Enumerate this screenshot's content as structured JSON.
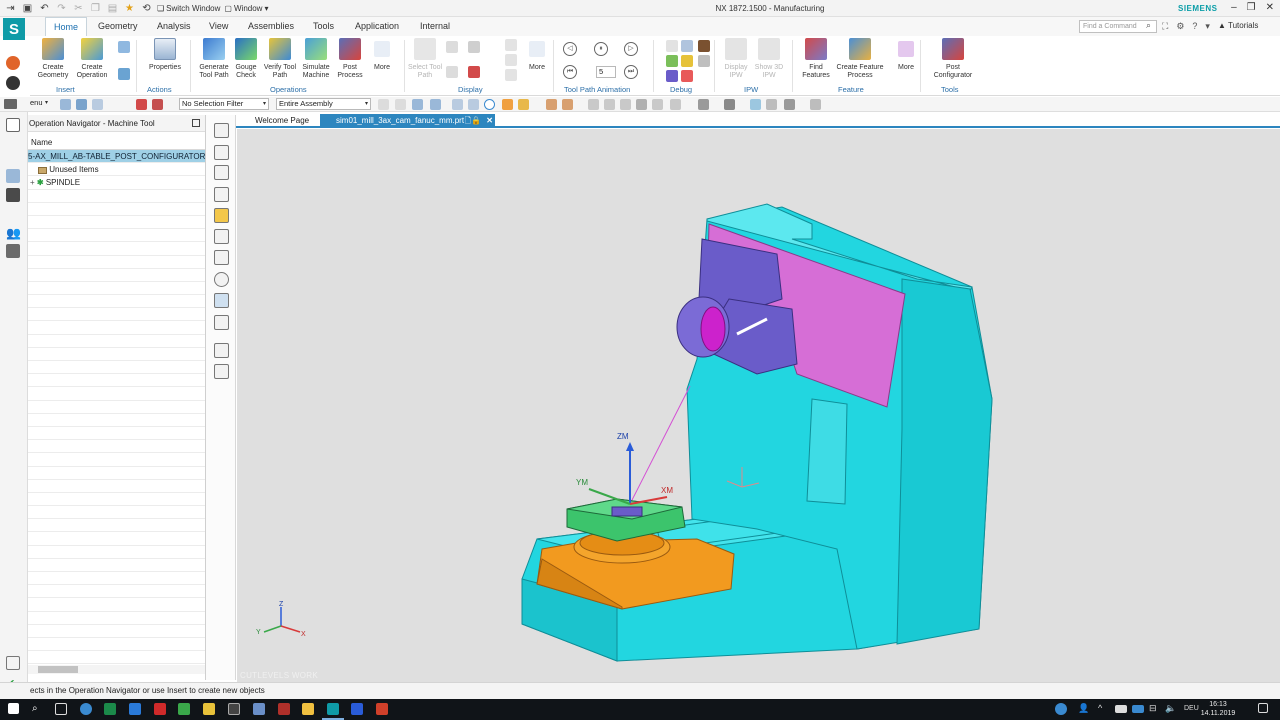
{
  "window": {
    "title": "NX 1872.1500 - Manufacturing",
    "brand": "SIEMENS",
    "switch_window_label": "Switch Window",
    "window_menu_label": "Window"
  },
  "tabs": [
    "Home",
    "Geometry",
    "Analysis",
    "View",
    "Assemblies",
    "Tools",
    "Application",
    "Internal"
  ],
  "command_search": {
    "placeholder": "Find a Command"
  },
  "tutorials_label": "Tutorials",
  "ribbon": {
    "insert": {
      "label": "Insert",
      "create_geometry": "Create Geometry",
      "create_operation": "Create Operation"
    },
    "actions": {
      "label": "Actions",
      "properties": "Properties"
    },
    "operations": {
      "label": "Operations",
      "generate_tool_path": "Generate Tool Path",
      "gouge_check": "Gouge Check",
      "verify_tool_path": "Verify Tool Path",
      "simulate_machine": "Simulate Machine",
      "post_process": "Post Process",
      "more": "More"
    },
    "display": {
      "label": "Display",
      "select_tool_path": "Select Tool Path",
      "more": "More"
    },
    "tool_path_animation": {
      "label": "Tool Path Animation",
      "speed": "5"
    },
    "debug": {
      "label": "Debug"
    },
    "ipw": {
      "label": "IPW",
      "display_ipw": "Display IPW",
      "show_3d_ipw": "Show 3D IPW"
    },
    "feature": {
      "label": "Feature",
      "find_features": "Find Features",
      "create_feature_process": "Create Feature Process",
      "more": "More"
    },
    "tools": {
      "label": "Tools",
      "post_configurator": "Post Configurator"
    }
  },
  "selection_bar": {
    "menu_label": "enu",
    "selection_filter": "No Selection Filter",
    "scope": "Entire Assembly"
  },
  "navigator": {
    "title": "Operation Navigator - Machine Tool",
    "column_name": "Name",
    "rows": [
      "5-AX_MILL_AB-TABLE_POST_CONFIGURATOR_ME",
      "Unused Items",
      "SPINDLE"
    ]
  },
  "doc_tabs": [
    "Welcome Page",
    "sim01_mill_3ax_cam_fanuc_mm.prt"
  ],
  "viewport": {
    "axis_labels": {
      "zm": "ZM",
      "ym": "YM",
      "xm": "XM"
    },
    "triad_labels": {
      "z": "Z",
      "y": "Y",
      "x": "X"
    },
    "watermark": "CUTLEVELS WORK",
    "colors": {
      "frame": "#22d6e0",
      "frame_edge": "#0f8e98",
      "spindle_housing": "#6a5cc9",
      "column_plate": "#d66ed6",
      "table_top": "#3cc46c",
      "rotary_base": "#f29a1f",
      "background": "#dfdfdf"
    }
  },
  "status": {
    "message": "ects in the Operation Navigator or use Insert to create new objects"
  },
  "taskbar": {
    "language": "DEU",
    "time": "16:13",
    "date": "14.11.2019"
  }
}
